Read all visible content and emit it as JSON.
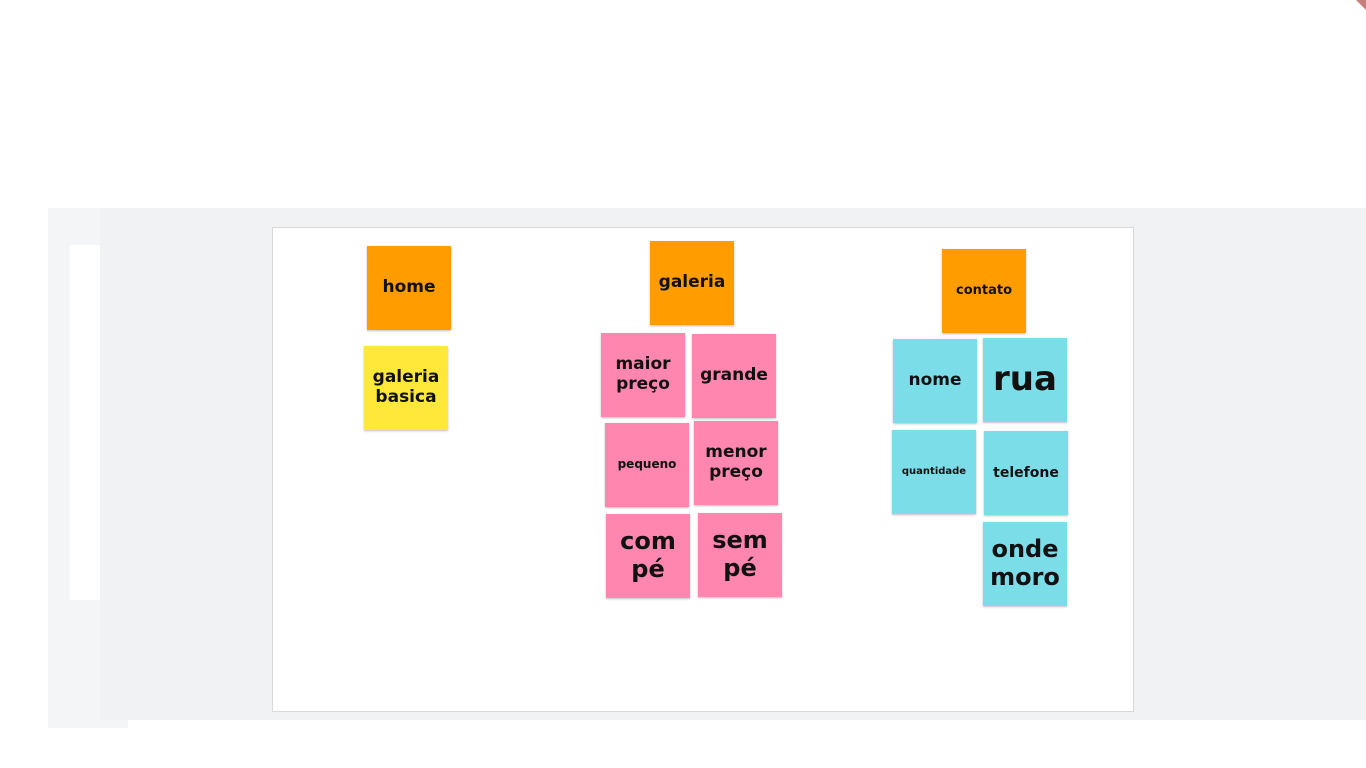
{
  "colors": {
    "orange": "#ff9d00",
    "yellow": "#ffe83a",
    "pink": "#ff86ae",
    "cyan": "#7adde8",
    "board": "#ffffff",
    "canvas": "#f1f2f4"
  },
  "columns": {
    "home": {
      "header": "home",
      "notes": [
        "galeria basica"
      ]
    },
    "galeria": {
      "header": "galeria",
      "notes": [
        "maior preço",
        "grande",
        "pequeno",
        "menor preço",
        "com pé",
        "sem pé"
      ]
    },
    "contato": {
      "header": "contato",
      "notes": [
        "nome",
        "rua",
        "quantidade",
        "telefone",
        "onde moro"
      ]
    }
  }
}
